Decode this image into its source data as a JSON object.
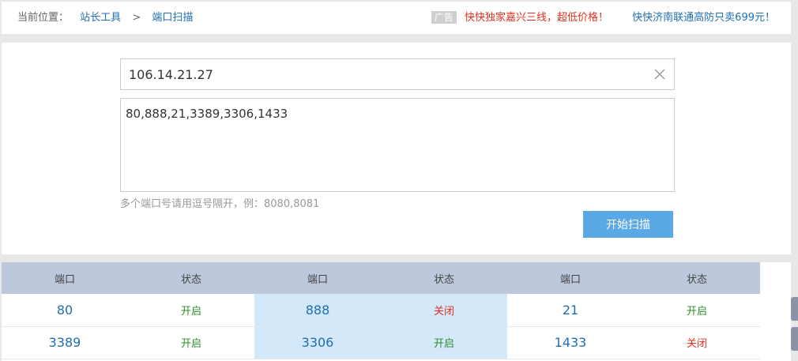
{
  "breadcrumb": {
    "label": "当前位置：",
    "items": [
      "站长工具",
      "端口扫描"
    ],
    "separator": ">"
  },
  "ads": {
    "tag": "广告",
    "link1": "快快独家嘉兴三线，超低价格！",
    "link2": "快快济南联通高防只卖699元！"
  },
  "form": {
    "host_value": "106.14.21.27",
    "ports_value": "80,888,21,3389,3306,1433",
    "hint": "多个端口号请用逗号隔开，例：8080,8081",
    "scan_button": "开始扫描"
  },
  "results": {
    "headers": [
      "端口",
      "状态",
      "端口",
      "状态",
      "端口",
      "状态"
    ],
    "rows": [
      [
        {
          "port": "80",
          "status": "开启",
          "state": "open"
        },
        {
          "port": "888",
          "status": "关闭",
          "state": "closed"
        },
        {
          "port": "21",
          "status": "开启",
          "state": "open"
        }
      ],
      [
        {
          "port": "3389",
          "status": "开启",
          "state": "open"
        },
        {
          "port": "3306",
          "status": "开启",
          "state": "open"
        },
        {
          "port": "1433",
          "status": "关闭",
          "state": "closed"
        }
      ]
    ]
  },
  "colors": {
    "link": "#1f6eb0",
    "ad_red": "#e0301e",
    "open": "#2e8b2e",
    "closed": "#e0301e",
    "button": "#5aa8e4",
    "table_header": "#bec8dd",
    "highlight_cell": "#d3e8f8"
  },
  "icons": {
    "clear": "close-icon"
  }
}
